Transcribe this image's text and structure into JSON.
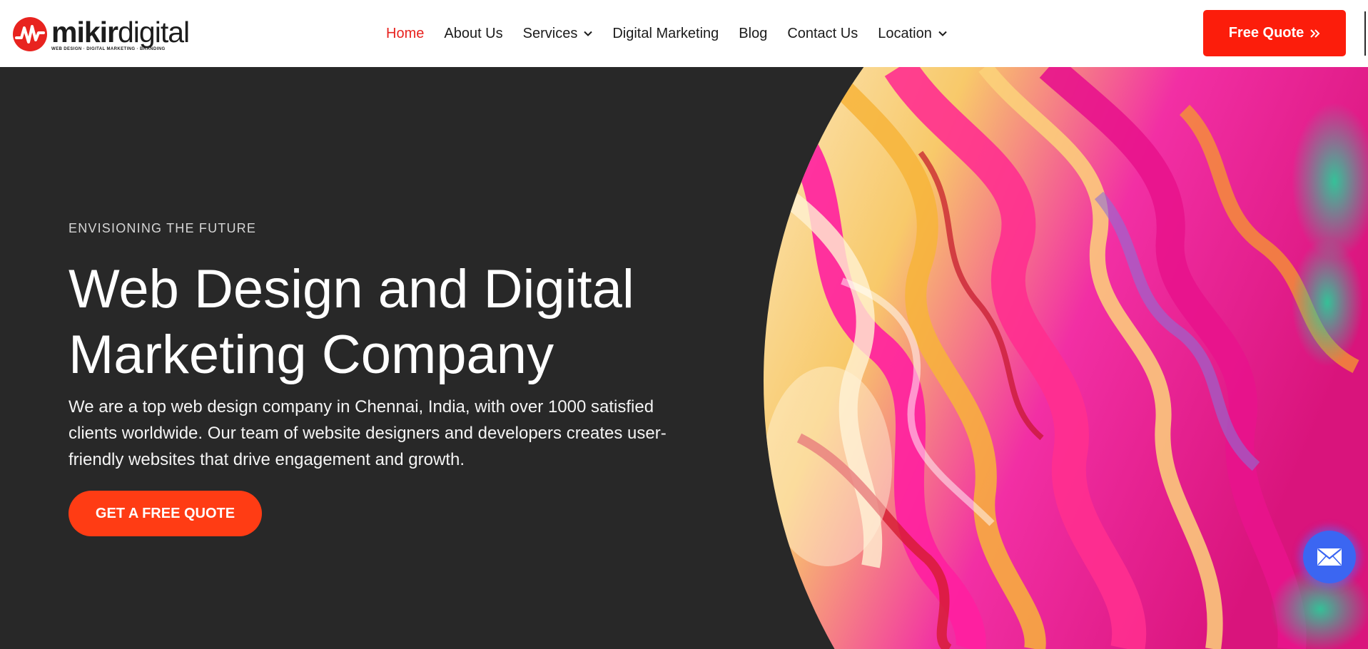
{
  "brand": {
    "name_bold": "mikir",
    "name_light": "digital",
    "tagline": "WEB DESIGN · DIGITAL MARKETING · BRANDING",
    "logo_icon": "pulse-circle-icon",
    "accent_color": "#e8231f"
  },
  "nav": {
    "items": [
      {
        "label": "Home",
        "active": true
      },
      {
        "label": "About Us"
      },
      {
        "label": "Services",
        "has_dropdown": true
      },
      {
        "label": "Digital Marketing"
      },
      {
        "label": "Blog"
      },
      {
        "label": "Contact Us"
      },
      {
        "label": "Location",
        "has_dropdown": true
      }
    ],
    "quote_button": {
      "label": "Free Quote",
      "icon": "double-chevron-right-icon"
    }
  },
  "hero": {
    "eyebrow": "ENVISIONING THE FUTURE",
    "headline_line1": "Web Design and Digital",
    "headline_line2": "Marketing Company",
    "description": "We are a top web design company in Chennai, India, with over 1000 satisfied clients worldwide. Our team of website designers and developers creates user-friendly websites that drive engagement and growth.",
    "cta_label": "GET A FREE QUOTE",
    "background_color": "#282828",
    "cta_color": "#ff3c14"
  },
  "chat_widget": {
    "icon": "mail-icon",
    "color": "#3b66f2"
  }
}
